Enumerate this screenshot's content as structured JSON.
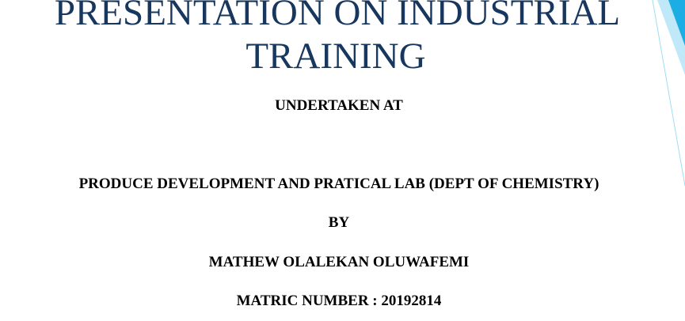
{
  "slide": {
    "title_line1": "PRESENTATION ON INDUSTRIAL",
    "title_line2": "TRAINING",
    "undertaken": "UNDERTAKEN AT",
    "place": "PRODUCE DEVELOPMENT AND PRATICAL LAB (DEPT OF CHEMISTRY)",
    "by": "BY",
    "name": "MATHEW OLALEKAN OLUWAFEMI",
    "matric": "MATRIC NUMBER : 20192814"
  },
  "colors": {
    "title": "#17375e",
    "body_text": "#000000",
    "accent_dark": "#1cade4",
    "accent_light": "#9fdcf4"
  }
}
